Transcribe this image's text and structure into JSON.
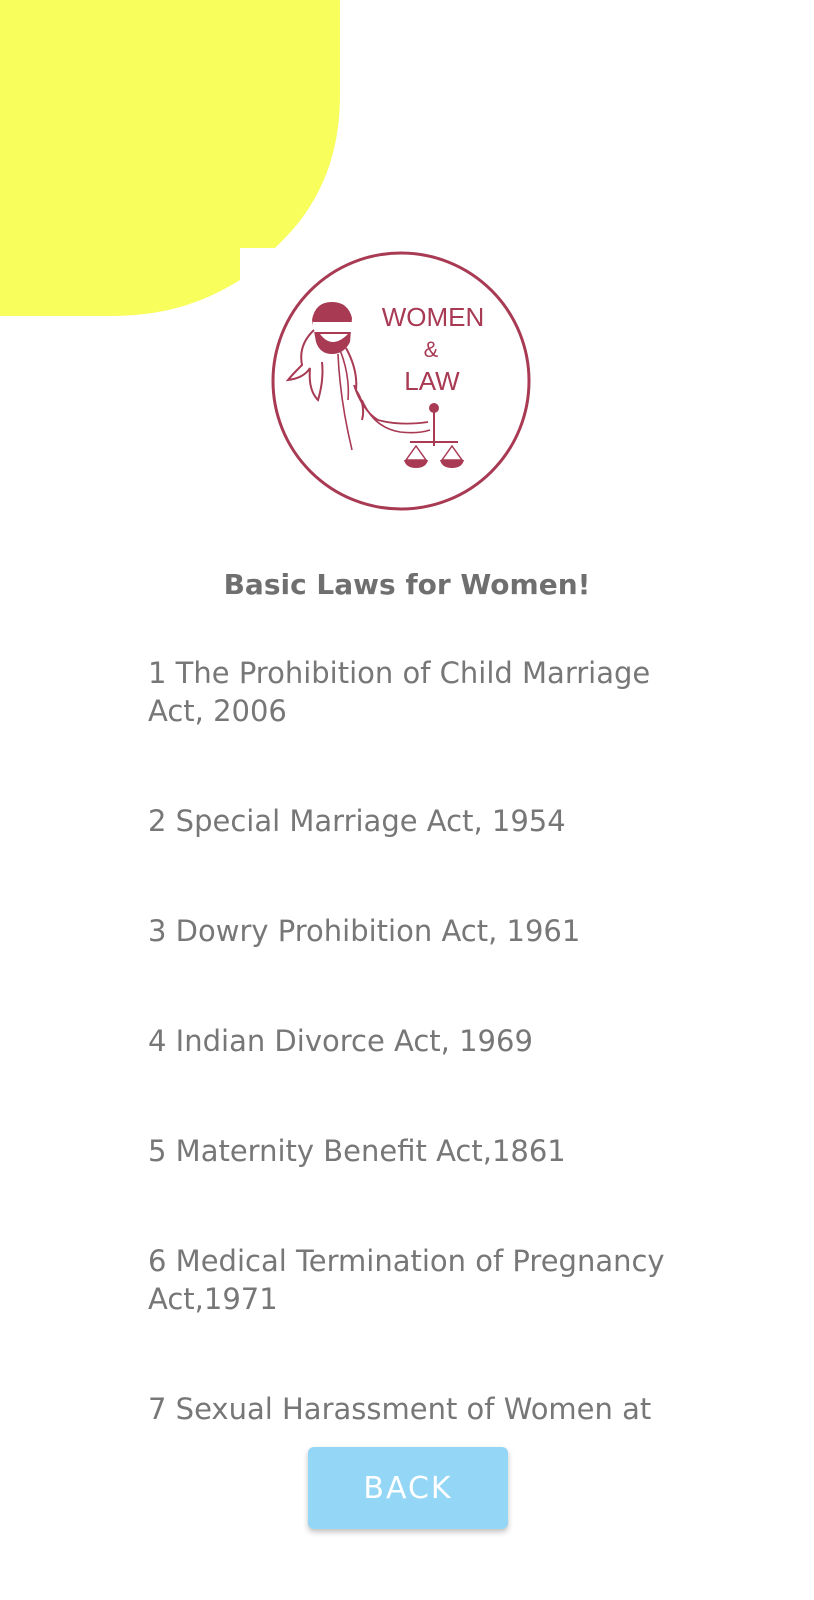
{
  "logo": {
    "line1": "WOMEN",
    "line2": "&",
    "line3": "LAW"
  },
  "page_title": "Basic Laws for Women!",
  "laws": [
    "1 The Prohibition of Child Marriage Act, 2006",
    "2 Special Marriage Act, 1954",
    "3 Dowry Prohibition Act, 1961",
    "4 Indian Divorce Act, 1969",
    "5 Maternity Benefit Act,1861",
    "6 Medical Termination of Pregnancy Act,1971",
    "7 Sexual Harassment of Women at"
  ],
  "back_button": "BACK",
  "colors": {
    "blob": "#f8ff5c",
    "logo": "#a83a54",
    "text": "#777777",
    "button": "#94d6f5"
  }
}
